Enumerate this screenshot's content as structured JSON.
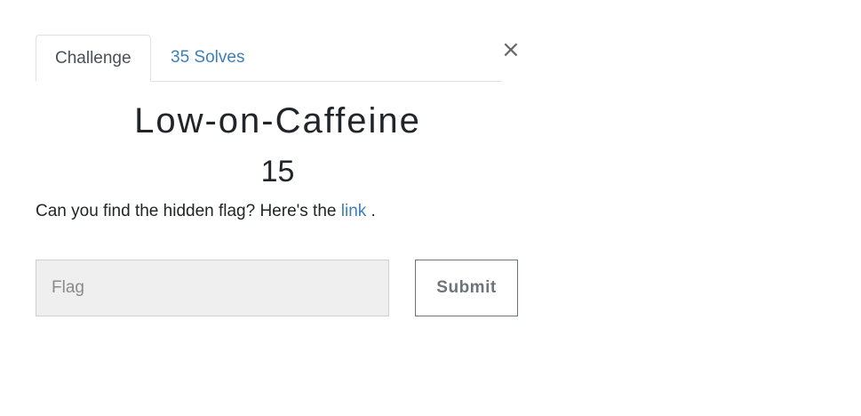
{
  "tabs": {
    "challenge": "Challenge",
    "solves": "35 Solves"
  },
  "close_icon": "×",
  "challenge": {
    "name": "Low-on-Caffeine",
    "points": "15",
    "description_prefix": "Can you find the hidden flag? Here's the ",
    "link_text": "link",
    "description_suffix": " ."
  },
  "form": {
    "flag_placeholder": "Flag",
    "flag_value": "",
    "submit_label": "Submit"
  },
  "colors": {
    "link": "#3e7fb9",
    "input_bg": "#efefef",
    "button_border": "#6c757d"
  }
}
